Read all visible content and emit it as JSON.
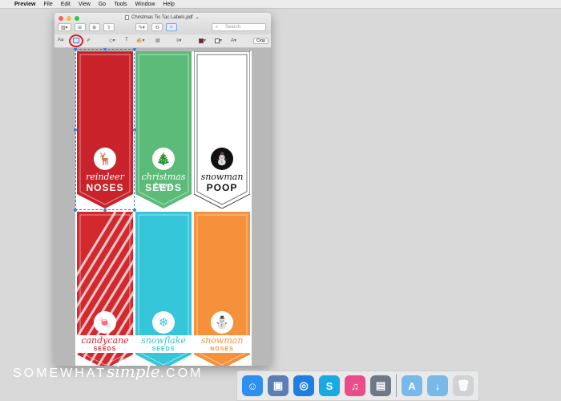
{
  "menubar": {
    "app": "Preview",
    "items": [
      "File",
      "Edit",
      "View",
      "Go",
      "Tools",
      "Window",
      "Help"
    ]
  },
  "window": {
    "title": "Christmas Tic Tac Labels.pdf",
    "search_placeholder": "Search",
    "font_button": "Aa",
    "crop_label": "Crop"
  },
  "labels": [
    {
      "script": "reindeer",
      "block": "NOSES",
      "color": "#c8232b",
      "icon": "reindeer-icon",
      "glyph": "🦌",
      "text_color": "#ffffff"
    },
    {
      "script": "christmas tree",
      "block": "SEEDS",
      "color": "#5dbb7a",
      "icon": "christmas-tree-icon",
      "glyph": "🎄",
      "text_color": "#ffffff"
    },
    {
      "script": "snowman",
      "block": "POOP",
      "color": "#ffffff",
      "icon": "snowman-icon",
      "glyph": "⛄",
      "text_color": "#111111"
    },
    {
      "script": "candycane",
      "block": "SEEDS",
      "color": "#d3282e",
      "icon": "candy-cane-icon",
      "glyph": "🍬",
      "text_color": "#d3282e"
    },
    {
      "script": "snowflake",
      "block": "SEEDS",
      "color": "#35c6d9",
      "icon": "snowflake-icon",
      "glyph": "❄",
      "text_color": "#35c6d9"
    },
    {
      "script": "snowman",
      "block": "NOSES",
      "color": "#f5913a",
      "icon": "snowman-face-icon",
      "glyph": "⛄",
      "text_color": "#f5913a"
    }
  ],
  "dock": {
    "apps": [
      {
        "name": "finder-icon",
        "glyph": "☺",
        "color": "#2f8ff0"
      },
      {
        "name": "preview-icon",
        "glyph": "▣",
        "color": "#5a7fb5"
      },
      {
        "name": "safari-icon",
        "glyph": "◎",
        "color": "#1e7fe0"
      },
      {
        "name": "skype-icon",
        "glyph": "S",
        "color": "#19a9e5"
      },
      {
        "name": "itunes-icon",
        "glyph": "♫",
        "color": "#e84d8a"
      },
      {
        "name": "image-capture-icon",
        "glyph": "▤",
        "color": "#6d7a86"
      }
    ],
    "folders": [
      {
        "name": "applications-folder-icon",
        "glyph": "A",
        "color": "#79b9ea"
      },
      {
        "name": "downloads-folder-icon",
        "glyph": "↓",
        "color": "#79b9ea"
      },
      {
        "name": "trash-icon",
        "glyph": "🗑",
        "color": "#cfd3d6"
      }
    ]
  },
  "watermark": {
    "left": "SOMEWHAT",
    "script": "simple",
    "right": ".COM"
  }
}
